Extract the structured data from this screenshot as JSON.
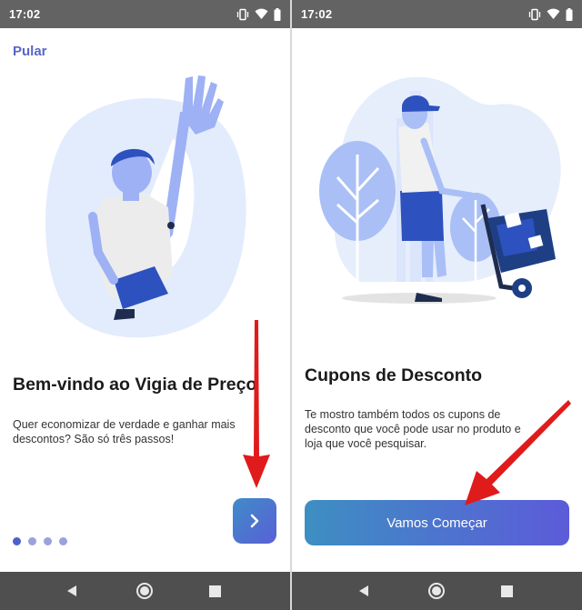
{
  "status_bar": {
    "time": "17:02"
  },
  "onboarding_1": {
    "skip_label": "Pular",
    "title": "Bem-vindo ao Vigia de Preço",
    "description": "Quer economizar de verdade e ganhar mais descontos? São só três passos!",
    "page_indicator": {
      "total": 4,
      "active": 1
    }
  },
  "onboarding_2": {
    "title": "Cupons de Desconto",
    "description": "Te mostro também todos os cupons de desconto que você pode usar no produto e loja que você pesquisar.",
    "start_label": "Vamos Começar"
  },
  "colors": {
    "accent": "#5866c8",
    "status_bar": "#636363",
    "nav_bar": "#4f4f4f",
    "annotation_arrow": "#e01b1b",
    "button_gradient_start": "#3d8fc2",
    "button_gradient_end": "#5c5bd9"
  },
  "icons": {
    "status": [
      "vibrate-icon",
      "wifi-icon",
      "battery-icon"
    ],
    "nav": [
      "back-icon",
      "home-icon",
      "recents-icon"
    ],
    "next": "chevron-right-icon"
  }
}
